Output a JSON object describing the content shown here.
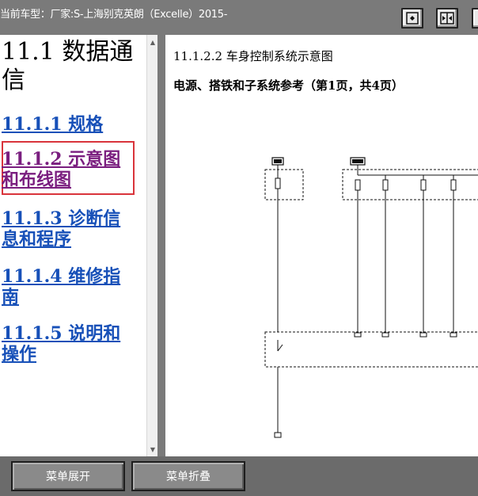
{
  "titlebar": {
    "title": "当前车型：厂家:S-上海别克英朗（Excelle）2015-"
  },
  "left_panel": {
    "heading": "11.1 数据通信",
    "links": [
      {
        "label": "11.1.1 规格"
      },
      {
        "label": "11.1.2 示意图和布线图"
      },
      {
        "label": "11.1.3 诊断信息和程序"
      },
      {
        "label": "11.1.4 维修指南"
      },
      {
        "label": "11.1.5 说明和操作"
      }
    ]
  },
  "right_panel": {
    "title": "11.1.2.2 车身控制系统示意图",
    "subtitle": "电源、搭铁和子系统参考（第1页，共4页）"
  },
  "bottom": {
    "expand_label": "菜单展开",
    "collapse_label": "菜单折叠"
  }
}
